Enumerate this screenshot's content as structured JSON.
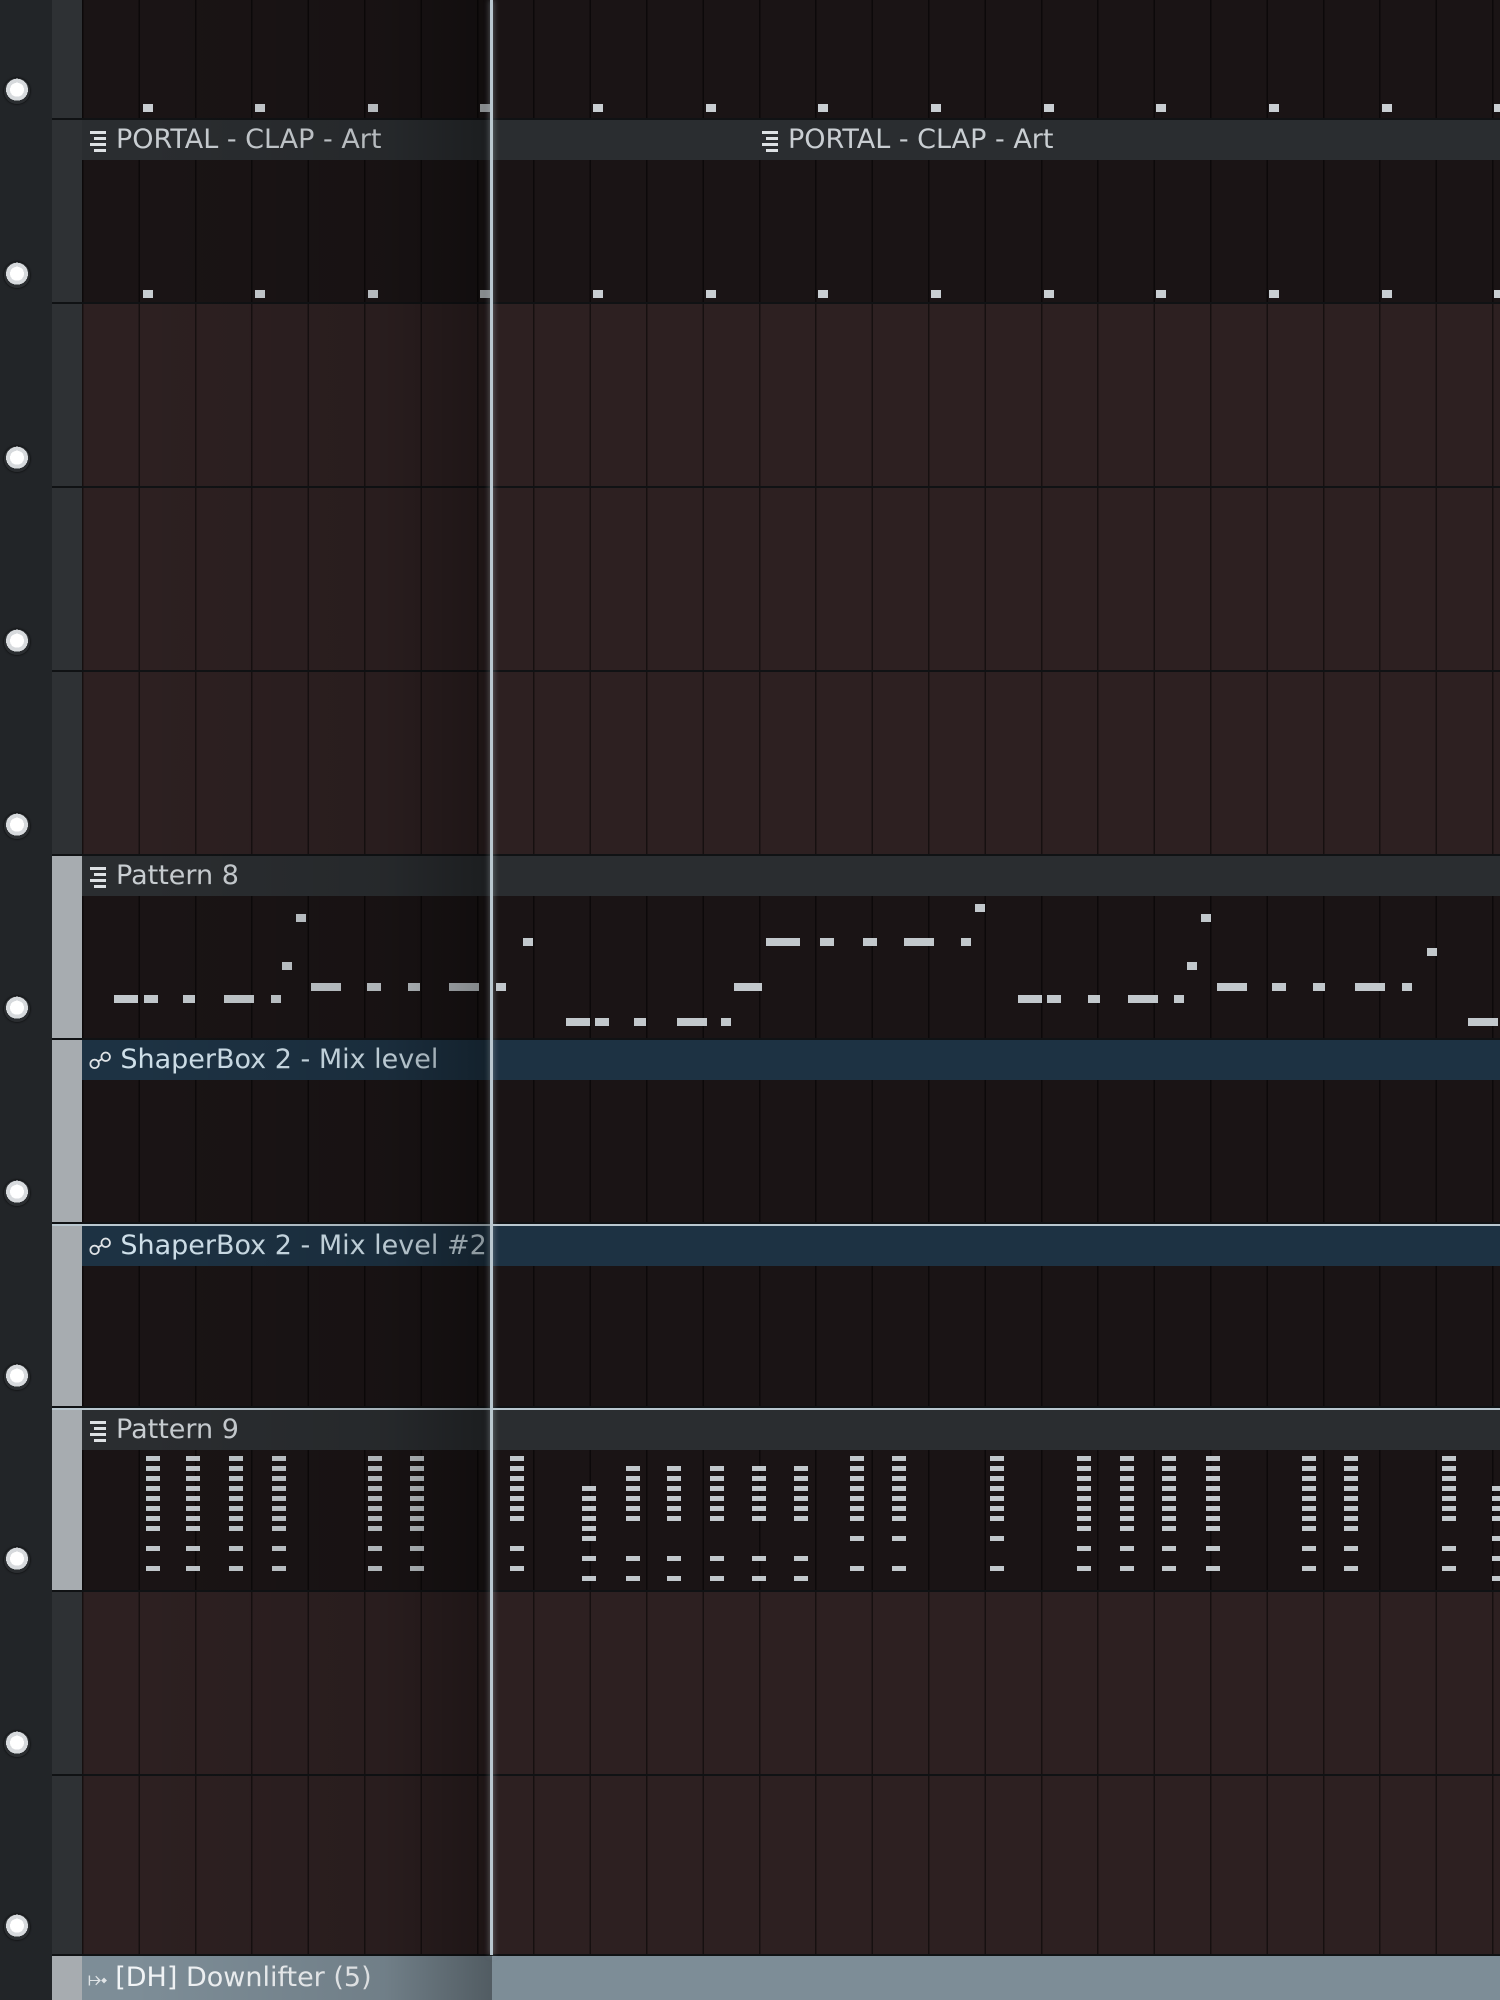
{
  "tracks": [
    {
      "id": 1,
      "kind": "pattern-clip",
      "clips": []
    },
    {
      "id": 2,
      "kind": "pattern-clip",
      "clips": [
        "PORTAL - CLAP - Art",
        "PORTAL - CLAP - Art"
      ]
    },
    {
      "id": 3,
      "kind": "empty"
    },
    {
      "id": 4,
      "kind": "empty"
    },
    {
      "id": 5,
      "kind": "empty"
    },
    {
      "id": 6,
      "kind": "pattern-clip",
      "clips": [
        "Pattern 8"
      ]
    },
    {
      "id": 7,
      "kind": "automation-clip",
      "clips": [
        "ShaperBox 2 - Mix level"
      ]
    },
    {
      "id": 8,
      "kind": "automation-clip",
      "clips": [
        "ShaperBox 2 - Mix level #2"
      ]
    },
    {
      "id": 9,
      "kind": "pattern-clip",
      "clips": [
        "Pattern 9"
      ]
    },
    {
      "id": 10,
      "kind": "empty"
    },
    {
      "id": 11,
      "kind": "empty"
    },
    {
      "id": 12,
      "kind": "audio-clip",
      "clips": [
        "[DH] Downlifter (5)"
      ]
    }
  ],
  "icons": {
    "pattern": "pattern-clip-icon",
    "automation": "automation-curve-icon",
    "audio": "audio-clip-icon"
  },
  "colors": {
    "automation_header": "#1d3243",
    "audio_header": "#7d8d97",
    "pattern_header": "#2a2d30",
    "playhead": "#b9c7cf",
    "note": "#c2c8cc"
  }
}
